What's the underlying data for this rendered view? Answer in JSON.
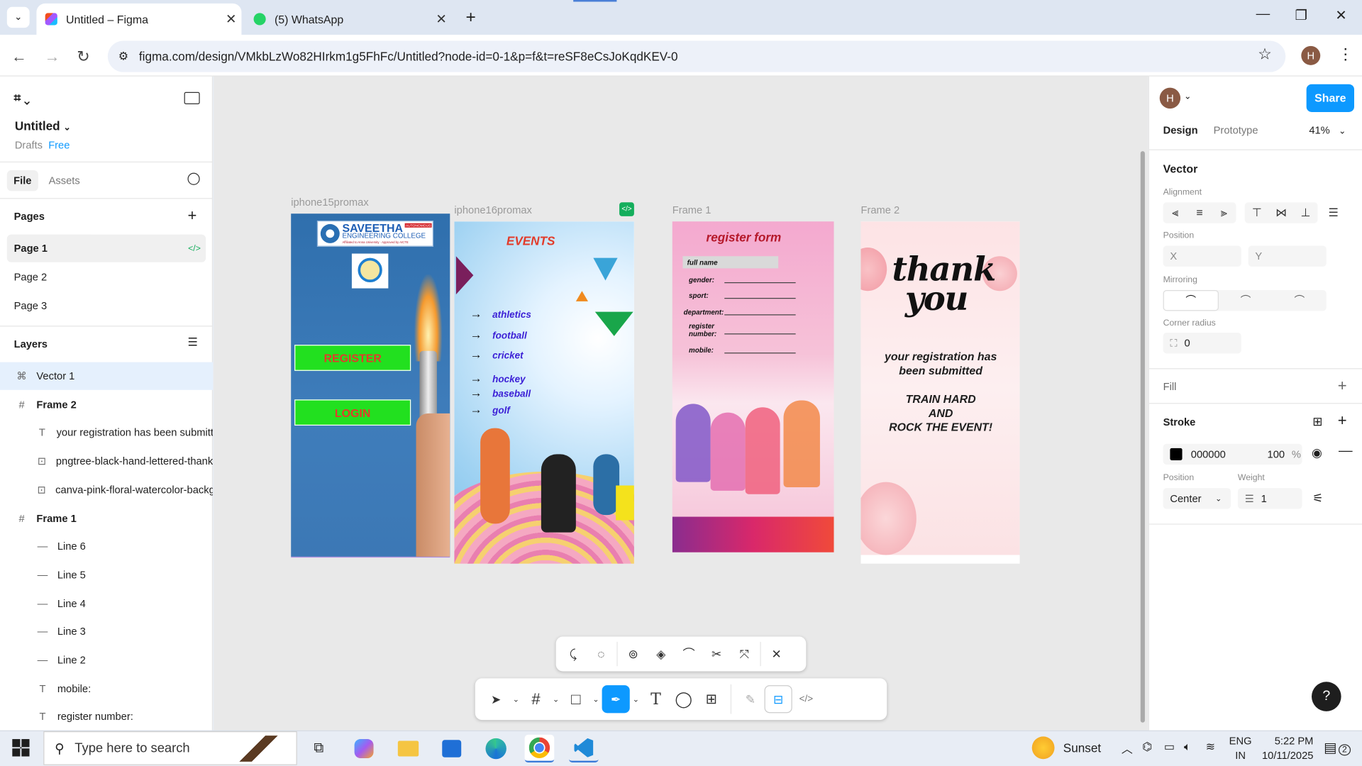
{
  "browser": {
    "tabs": [
      {
        "title": "Untitled – Figma",
        "active": true
      },
      {
        "title": "(5) WhatsApp",
        "active": false
      }
    ],
    "url": "figma.com/design/VMkbLzWo82HIrkm1g5FhFc/Untitled?node-id=0-1&p=f&t=reSF8eCsJoKqdKEV-0",
    "profile_initial": "H"
  },
  "file": {
    "name": "Untitled",
    "location": "Drafts",
    "plan": "Free"
  },
  "left_tabs": {
    "file": "File",
    "assets": "Assets"
  },
  "pages": {
    "title": "Pages",
    "items": [
      "Page 1",
      "Page 2",
      "Page 3"
    ]
  },
  "layers": {
    "title": "Layers",
    "items": [
      {
        "name": "Vector 1",
        "icon": "vector",
        "indent": 0,
        "selected": true
      },
      {
        "name": "Frame 2",
        "icon": "frame",
        "indent": 0,
        "bold": true
      },
      {
        "name": "your registration has been submitted",
        "icon": "text",
        "indent": 1
      },
      {
        "name": "pngtree-black-hand-lettered-thank-you",
        "icon": "image",
        "indent": 1
      },
      {
        "name": "canva-pink-floral-watercolor-background",
        "icon": "image",
        "indent": 1
      },
      {
        "name": "Frame 1",
        "icon": "frame",
        "indent": 0,
        "bold": true
      },
      {
        "name": "Line 6",
        "icon": "line",
        "indent": 1
      },
      {
        "name": "Line 5",
        "icon": "line",
        "indent": 1
      },
      {
        "name": "Line 4",
        "icon": "line",
        "indent": 1
      },
      {
        "name": "Line 3",
        "icon": "line",
        "indent": 1
      },
      {
        "name": "Line 2",
        "icon": "line",
        "indent": 1
      },
      {
        "name": "mobile:",
        "icon": "text",
        "indent": 1
      },
      {
        "name": "register number:",
        "icon": "text",
        "indent": 1
      }
    ]
  },
  "right": {
    "share": "Share",
    "avatar": "H",
    "tabs": {
      "design": "Design",
      "prototype": "Prototype"
    },
    "zoom": "41%",
    "selection": "Vector",
    "alignment": "Alignment",
    "position": "Position",
    "x_placeholder": "X",
    "y_placeholder": "Y",
    "mirroring": "Mirroring",
    "corner_radius": "Corner radius",
    "radius_value": "0",
    "fill": "Fill",
    "stroke": "Stroke",
    "stroke_color_hex": "000000",
    "stroke_opacity": "100",
    "percent": "%",
    "stroke_position_label": "Position",
    "stroke_position": "Center",
    "weight_label": "Weight",
    "weight": "1",
    "help": "?"
  },
  "frames": {
    "f1": {
      "label": "iphone15promax",
      "logo_line1": "SAVEETHA",
      "logo_line2": "ENGINEERING COLLEGE",
      "badge": "AUTONOMOUS",
      "logo_sub": "Affiliated to Anna University · Approved by AICTE",
      "register": "REGISTER",
      "login": "LOGIN"
    },
    "f2": {
      "label": "iphone16promax",
      "title": "EVENTS",
      "items": [
        "athletics",
        "football",
        "cricket",
        "hockey",
        "baseball",
        "golf"
      ]
    },
    "f3": {
      "label": "Frame 1",
      "title": "register form",
      "fields": [
        "full name",
        "gender:",
        "sport:",
        "department:",
        "register number:",
        "mobile:"
      ]
    },
    "f4": {
      "label": "Frame 2",
      "script": "thank you",
      "msg1": "your registration has been submitted",
      "msg2": "TRAIN HARD",
      "msg3": "AND",
      "msg4": "ROCK THE EVENT!"
    }
  },
  "taskbar": {
    "search_placeholder": "Type here to search",
    "weather": "Sunset",
    "lang1": "ENG",
    "lang2": "IN",
    "time": "5:22 PM",
    "date": "10/11/2025",
    "notif": "2"
  },
  "colors": {
    "accent": "#0d99ff",
    "green_btn": "#22e01f",
    "events_red": "#e23b2a",
    "form_red": "#b5182a",
    "link_purple": "#3b1fd6"
  }
}
